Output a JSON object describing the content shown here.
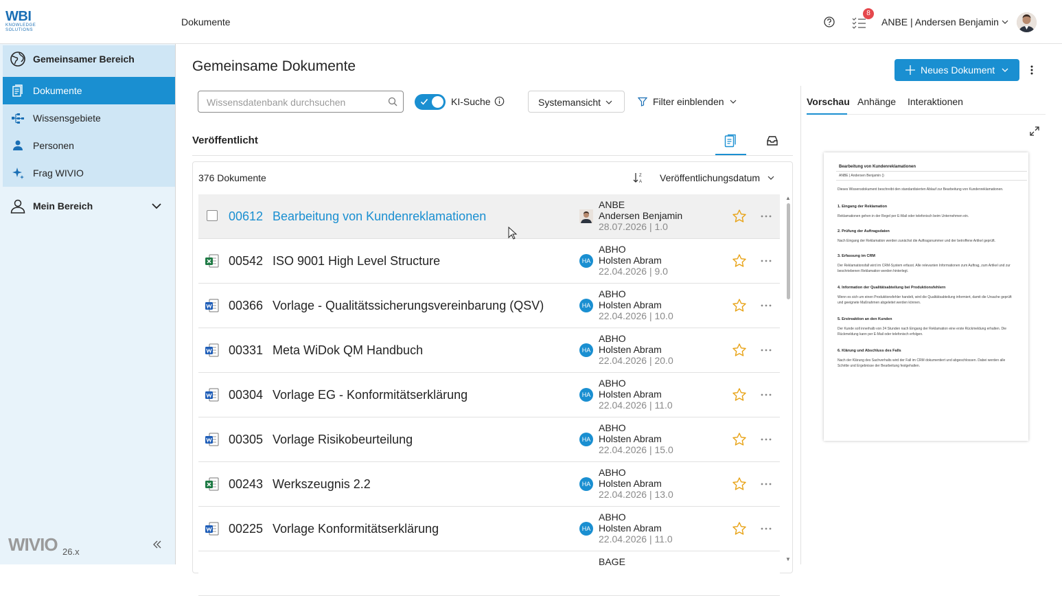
{
  "header": {
    "logo_main": "WBI",
    "logo_sub1": "KNOWLEDGE",
    "logo_sub2": "SOLUTIONS",
    "breadcrumb": "Dokumente",
    "notifications_count": "8",
    "user_label": "ANBE | Andersen Benjamin"
  },
  "sidebar": {
    "shared_area": "Gemeinsamer Bereich",
    "items": [
      {
        "label": "Dokumente",
        "icon": "documents-icon",
        "active": true
      },
      {
        "label": "Wissensgebiete",
        "icon": "knowledge-tree-icon",
        "active": false
      },
      {
        "label": "Personen",
        "icon": "person-icon",
        "active": false
      },
      {
        "label": "Frag WIVIO",
        "icon": "sparkle-icon",
        "active": false
      }
    ],
    "my_area": "Mein Bereich",
    "brand": "WIVIO",
    "version": "26.x"
  },
  "main": {
    "title": "Gemeinsame Dokumente",
    "search_placeholder": "Wissensdatenbank durchsuchen",
    "ki_label": "KI-Suche",
    "ki_enabled": true,
    "view_select": "Systemansicht",
    "filter_label": "Filter einblenden",
    "section_title": "Veröffentlicht",
    "count_label": "376 Dokumente",
    "sort_label": "Veröffentlichungsdatum",
    "new_doc_label": "Neues Dokument"
  },
  "documents": [
    {
      "number": "00612",
      "title": "Bearbeitung von Kundenreklamationen",
      "type": "none",
      "short": "ANBE",
      "author": "Andersen Benjamin",
      "date": "28.07.2026 | 1.0",
      "initials": "",
      "selected": true
    },
    {
      "number": "00542",
      "title": "ISO 9001 High Level Structure",
      "type": "excel",
      "short": "ABHO",
      "author": "Holsten Abram",
      "date": "22.04.2026 | 9.0",
      "initials": "HA",
      "selected": false
    },
    {
      "number": "00366",
      "title": "Vorlage - Qualitätssicherungsvereinbarung (QSV)",
      "type": "word",
      "short": "ABHO",
      "author": "Holsten Abram",
      "date": "22.04.2026 | 10.0",
      "initials": "HA",
      "selected": false
    },
    {
      "number": "00331",
      "title": "Meta WiDok QM Handbuch",
      "type": "word",
      "short": "ABHO",
      "author": "Holsten Abram",
      "date": "22.04.2026 | 20.0",
      "initials": "HA",
      "selected": false
    },
    {
      "number": "00304",
      "title": "Vorlage EG - Konformitätserklärung",
      "type": "word",
      "short": "ABHO",
      "author": "Holsten Abram",
      "date": "22.04.2026 | 11.0",
      "initials": "HA",
      "selected": false
    },
    {
      "number": "00305",
      "title": "Vorlage Risikobeurteilung",
      "type": "word",
      "short": "ABHO",
      "author": "Holsten Abram",
      "date": "22.04.2026 | 15.0",
      "initials": "HA",
      "selected": false
    },
    {
      "number": "00243",
      "title": "Werkszeugnis 2.2",
      "type": "excel",
      "short": "ABHO",
      "author": "Holsten Abram",
      "date": "22.04.2026 | 13.0",
      "initials": "HA",
      "selected": false
    },
    {
      "number": "00225",
      "title": "Vorlage Konformitätserklärung",
      "type": "word",
      "short": "ABHO",
      "author": "Holsten Abram",
      "date": "22.04.2026 | 11.0",
      "initials": "HA",
      "selected": false
    },
    {
      "number": "",
      "title": "",
      "type": "none",
      "short": "BAGE",
      "author": "",
      "date": "",
      "initials": "",
      "selected": false
    }
  ],
  "preview": {
    "tabs": [
      "Vorschau",
      "Anhänge",
      "Interaktionen"
    ],
    "doc_title": "Bearbeitung von Kundenreklamationen",
    "doc_owner": "ANBE | Andersen Benjamin ()",
    "intro": "Dieses Wissensdokument beschreibt den standardisierten Ablauf zur Bearbeitung von Kundenreklamationen.",
    "sections": [
      {
        "heading": "1. Eingang der Reklamation",
        "text": "Reklamationen gehen in der Regel per E-Mail oder telefonisch beim Unternehmen ein."
      },
      {
        "heading": "2. Prüfung der Auftragsdaten",
        "text": "Nach Eingang der Reklamation werden zunächst die Auftragsnummer und der betroffene Artikel geprüft."
      },
      {
        "heading": "3. Erfassung im CRM",
        "text": "Der Reklamationsfall wird im CRM-System erfasst. Alle relevanten Informationen zum Auftrag, zum Artikel und zur beschriebenen Reklamation werden hinterlegt."
      },
      {
        "heading": "4. Information der Qualitätsabteilung bei Produktionsfehlern",
        "text": "Wenn es sich um einen Produktionsfehler handelt, wird die Qualitätsabteilung informiert, damit die Ursache geprüft und geeignete Maßnahmen abgeleitet werden können."
      },
      {
        "heading": "5. Erstreaktion an den Kunden",
        "text": "Der Kunde soll innerhalb von 24 Stunden nach Eingang der Reklamation eine erste Rückmeldung erhalten. Die Rückmeldung kann per E-Mail oder telefonisch erfolgen."
      },
      {
        "heading": "6. Klärung und Abschluss des Falls",
        "text": "Nach der Klärung des Sachverhalts wird der Fall im CRM dokumentiert und abgeschlossen. Dabei werden alle Schritte und Ergebnisse der Bearbeitung festgehalten."
      }
    ]
  },
  "colors": {
    "accent": "#1a8fd1",
    "sidebar_bg": "#e8f3fa",
    "badge": "#e5484d"
  }
}
